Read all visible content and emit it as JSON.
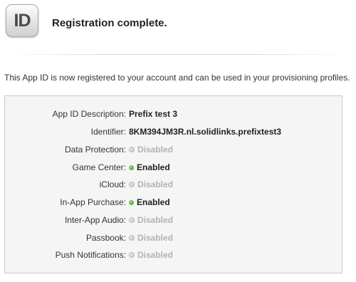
{
  "header": {
    "badge_text": "ID",
    "title": "Registration complete."
  },
  "intro_text": "This App ID is now registered to your account and can be used in your provisioning profiles.",
  "details": {
    "description": {
      "label": "App ID Description:",
      "value": "Prefix test 3"
    },
    "identifier": {
      "label": "Identifier:",
      "value": "8KM394JM3R.nl.solidlinks.prefixtest3"
    }
  },
  "services": [
    {
      "label": "Data Protection:",
      "status": "Disabled",
      "enabled": false
    },
    {
      "label": "Game Center:",
      "status": "Enabled",
      "enabled": true
    },
    {
      "label": "iCloud:",
      "status": "Disabled",
      "enabled": false
    },
    {
      "label": "In-App Purchase:",
      "status": "Enabled",
      "enabled": true
    },
    {
      "label": "Inter-App Audio:",
      "status": "Disabled",
      "enabled": false
    },
    {
      "label": "Passbook:",
      "status": "Disabled",
      "enabled": false
    },
    {
      "label": "Push Notifications:",
      "status": "Disabled",
      "enabled": false
    }
  ],
  "colors": {
    "enabled_dot": "#2e9e17",
    "disabled_dot": "#b9b9b9",
    "disabled_text": "#b3b3b3"
  }
}
